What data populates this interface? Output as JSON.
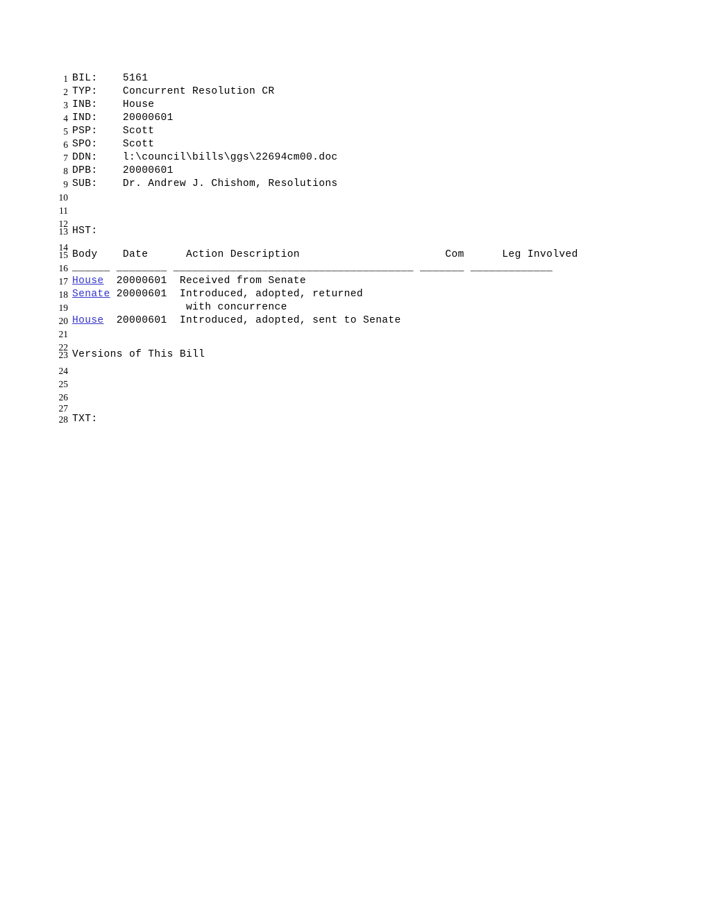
{
  "document": {
    "type": "legislative-bill-record",
    "font_char_width_px": 10.15,
    "link_color": "#3333cc",
    "text_color": "#000000",
    "background_color": "#ffffff"
  },
  "fields": [
    {
      "line": "1",
      "label": "BIL:",
      "value": "5161"
    },
    {
      "line": "2",
      "label": "TYP:",
      "value": "Concurrent Resolution CR"
    },
    {
      "line": "3",
      "label": "INB:",
      "value": "House"
    },
    {
      "line": "4",
      "label": "IND:",
      "value": "20000601"
    },
    {
      "line": "5",
      "label": "PSP:",
      "value": "Scott"
    },
    {
      "line": "6",
      "label": "SPO:",
      "value": "Scott"
    },
    {
      "line": "7",
      "label": "DDN:",
      "value": "l:\\council\\bills\\ggs\\22694cm00.doc"
    },
    {
      "line": "8",
      "label": "DPB:",
      "value": "20000601"
    },
    {
      "line": "9",
      "label": "SUB:",
      "value": "Dr. Andrew J. Chishom, Resolutions"
    }
  ],
  "history": {
    "line_blank_10": "10",
    "line_blank_11": "11",
    "line_blank_12": "12",
    "hst_line": "13",
    "hst_label": "HST:",
    "line_blank_14": "14",
    "header_line": "15",
    "separator_line": "16",
    "columns": [
      "Body",
      "Date",
      "Action Description",
      "Com",
      "Leg Involved"
    ],
    "separators": [
      "______",
      "________",
      "______________________________________",
      "_______",
      "_____________"
    ],
    "rows": [
      {
        "line": "17",
        "body": "House",
        "body_is_link": true,
        "date": "20000601",
        "action": "Received from Senate",
        "com": "",
        "leg": ""
      },
      {
        "line": "18",
        "body": "Senate",
        "body_is_link": true,
        "date": "20000601",
        "action": "Introduced, adopted, returned",
        "com": "",
        "leg": ""
      },
      {
        "line": "19",
        "body": "",
        "body_is_link": false,
        "date": "",
        "action": "with concurrence",
        "com": "",
        "leg": ""
      },
      {
        "line": "20",
        "body": "House",
        "body_is_link": true,
        "date": "20000601",
        "action": "Introduced, adopted, sent to Senate",
        "com": "",
        "leg": ""
      }
    ]
  },
  "versions": {
    "line_blank_21": "21",
    "line_blank_22": "22",
    "heading_line": "23",
    "heading": "Versions of This Bill",
    "line_blank_24": "24",
    "line_blank_25": "25",
    "line_blank_26": "26",
    "line_blank_27": "27"
  },
  "text_section": {
    "line": "28",
    "label": "TXT:"
  }
}
